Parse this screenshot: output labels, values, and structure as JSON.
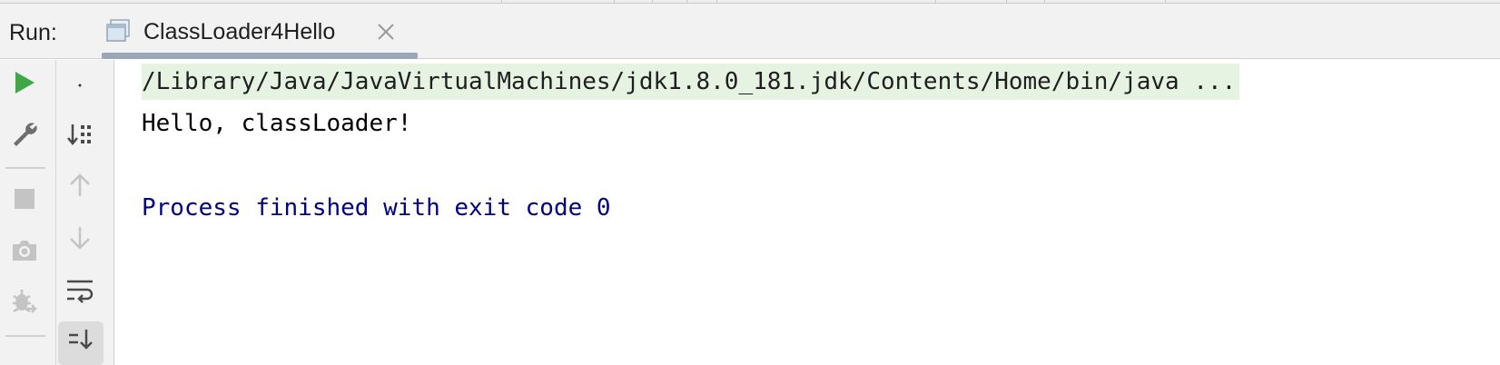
{
  "run_panel": {
    "label": "Run:",
    "tab": {
      "title": "ClassLoader4Hello",
      "icon": "application-config-icon"
    }
  },
  "toolbar": {
    "primary": [
      {
        "name": "rerun-icon",
        "color": "#3da845"
      },
      {
        "name": "wrench-icon",
        "color": "#6e6e6e"
      },
      {
        "name": "stop-icon",
        "color": "#c4c4c4"
      },
      {
        "name": "camera-icon",
        "color": "#c4c4c4"
      },
      {
        "name": "debug-icon",
        "color": "#c4c4c4"
      }
    ],
    "secondary": [
      {
        "name": "dot-icon"
      },
      {
        "name": "sort-icon"
      },
      {
        "name": "up-arrow-icon"
      },
      {
        "name": "down-arrow-icon"
      },
      {
        "name": "soft-wrap-icon"
      },
      {
        "name": "scroll-to-end-icon"
      }
    ]
  },
  "console": {
    "command_line": "/Library/Java/JavaVirtualMachines/jdk1.8.0_181.jdk/Contents/Home/bin/java ...",
    "output": "Hello, classLoader!",
    "exit_message": "Process finished with exit code 0",
    "colors": {
      "command_bg": "#e6f3e3",
      "exit_text": "#000080"
    }
  }
}
